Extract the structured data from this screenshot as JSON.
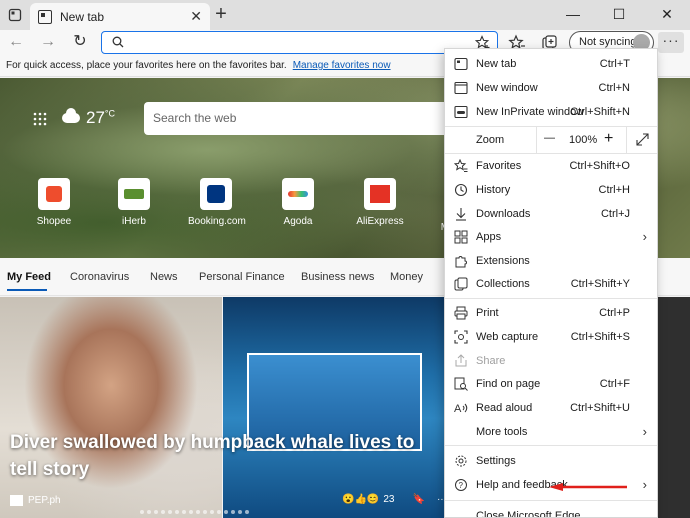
{
  "tab": {
    "title": "New tab"
  },
  "toolbar": {
    "sync_label": "Not syncing",
    "more_label": "···"
  },
  "favorites_bar": {
    "text": "For quick access, place your favorites here on the favorites bar.",
    "link": "Manage favorites now"
  },
  "hero": {
    "temperature": "27",
    "unit": "°C",
    "search_placeholder": "Search the web"
  },
  "quick_links": [
    {
      "label": "Shopee",
      "color": "#ee4d2d"
    },
    {
      "label": "iHerb",
      "color": "#5a8f2f"
    },
    {
      "label": "Booking.com",
      "color": "#003580"
    },
    {
      "label": "Agoda",
      "color": "#ffffff"
    },
    {
      "label": "AliExpress",
      "color": "#e43225"
    },
    {
      "label": "Mi",
      "color": "#ff6900"
    }
  ],
  "feed_nav": {
    "items": [
      "My Feed",
      "Coronavirus",
      "News",
      "Personal Finance",
      "Business news",
      "Money"
    ]
  },
  "article": {
    "headline": "Diver swallowed by humpback whale lives to tell story",
    "source": "PEP.ph",
    "reactions_count": "23"
  },
  "menu": {
    "new_tab": {
      "label": "New tab",
      "shortcut": "Ctrl+T"
    },
    "new_window": {
      "label": "New window",
      "shortcut": "Ctrl+N"
    },
    "inprivate": {
      "label": "New InPrivate window",
      "shortcut": "Ctrl+Shift+N"
    },
    "zoom": {
      "label": "Zoom",
      "value": "100%",
      "minus": "—",
      "plus": "+"
    },
    "favorites": {
      "label": "Favorites",
      "shortcut": "Ctrl+Shift+O"
    },
    "history": {
      "label": "History",
      "shortcut": "Ctrl+H"
    },
    "downloads": {
      "label": "Downloads",
      "shortcut": "Ctrl+J"
    },
    "apps": {
      "label": "Apps"
    },
    "extensions": {
      "label": "Extensions"
    },
    "collections": {
      "label": "Collections",
      "shortcut": "Ctrl+Shift+Y"
    },
    "print": {
      "label": "Print",
      "shortcut": "Ctrl+P"
    },
    "web_capture": {
      "label": "Web capture",
      "shortcut": "Ctrl+Shift+S"
    },
    "share": {
      "label": "Share"
    },
    "find_on_page": {
      "label": "Find on page",
      "shortcut": "Ctrl+F"
    },
    "read_aloud": {
      "label": "Read aloud",
      "shortcut": "Ctrl+Shift+U"
    },
    "more_tools": {
      "label": "More tools"
    },
    "settings": {
      "label": "Settings"
    },
    "help": {
      "label": "Help and feedback"
    },
    "close": {
      "label": "Close Microsoft Edge"
    }
  },
  "colors": {
    "accent": "#0a5ab7",
    "annotation_arrow": "#e0201b"
  }
}
